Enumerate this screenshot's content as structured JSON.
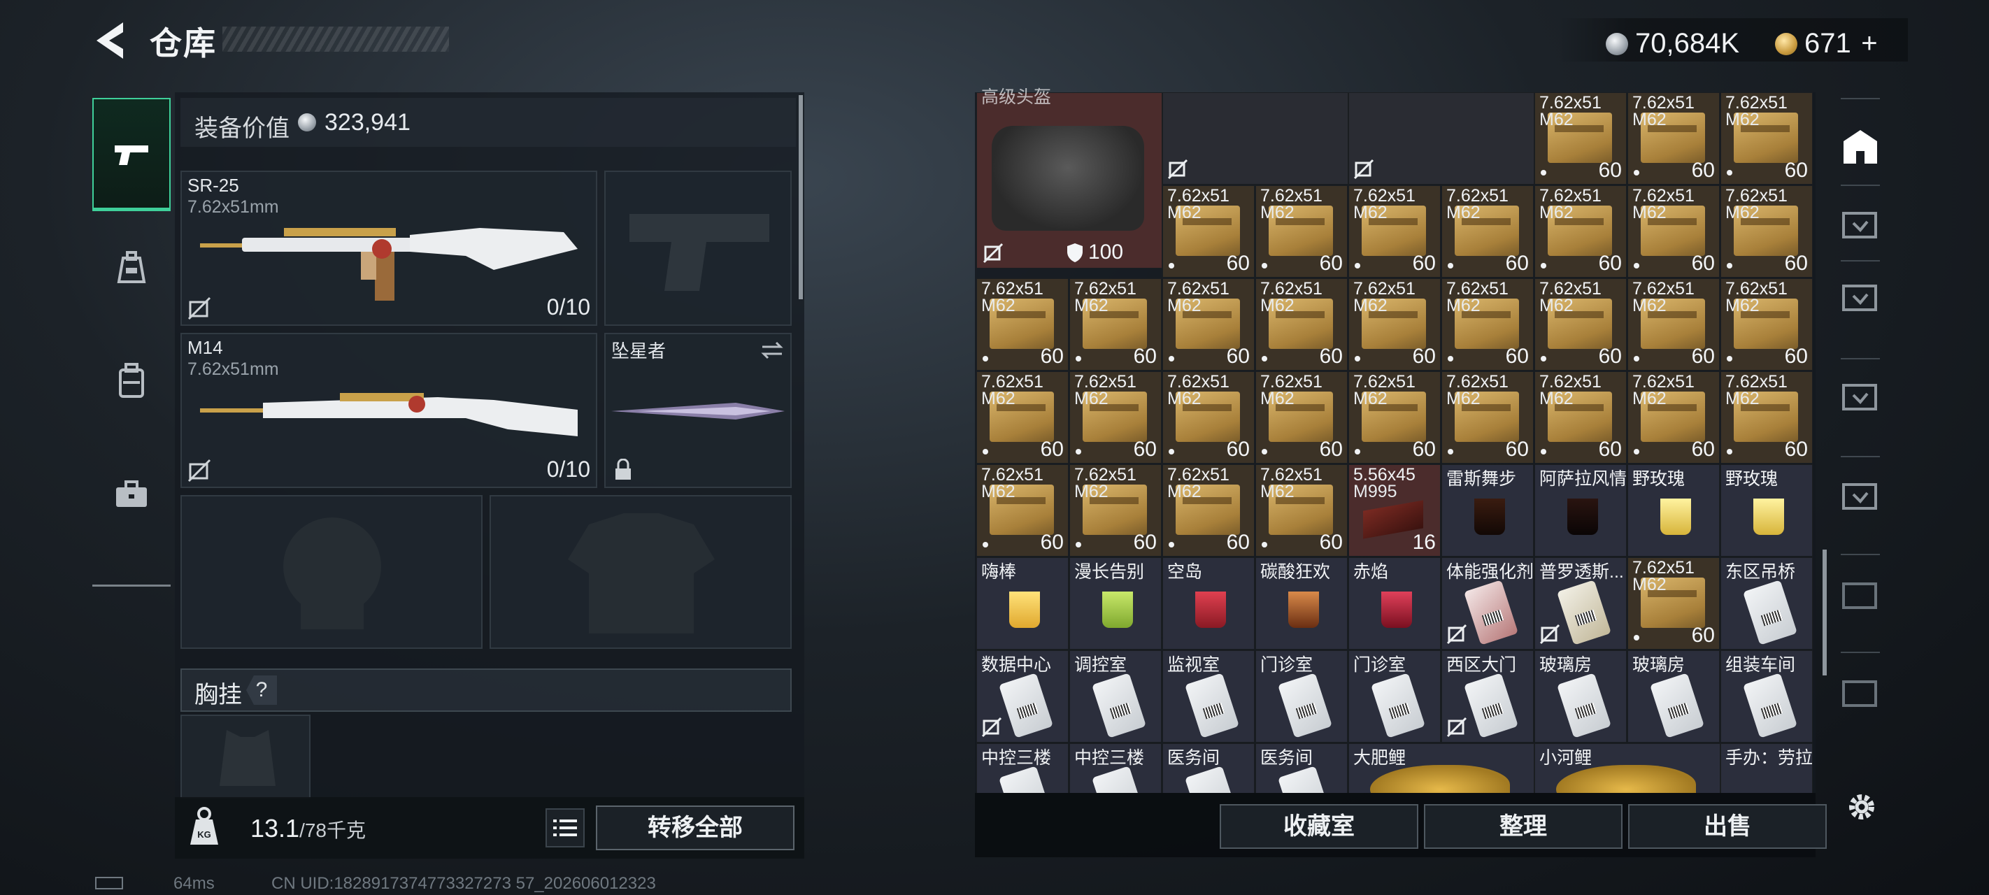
{
  "header": {
    "title": "仓库",
    "currency_silver": "70,684K",
    "currency_gold": "671",
    "add_symbol": "+"
  },
  "equipment": {
    "value_label": "装备价值",
    "value": "323,941",
    "slots": [
      {
        "name": "SR-25",
        "ammo": "7.62x51mm",
        "count": "0/10"
      },
      {
        "name": "M14",
        "ammo": "7.62x51mm",
        "count": "0/10"
      },
      {
        "name": "坠星者"
      }
    ],
    "chest_label": "胸挂",
    "chest_help": "?",
    "weight": "13.1",
    "weight_capacity": "/78千克",
    "transfer_all": "转移全部"
  },
  "status": {
    "ping": "64ms",
    "uid": "CN UID:1828917374773327273 57_202606012323"
  },
  "storage": {
    "top_label": "高级头盔",
    "bag_durability": "100",
    "ammo_line1": "7.62x51",
    "ammo_line2": "M62",
    "ammo_count": "60",
    "ammo556_line1": "5.56x45",
    "ammo556_line2": "M995",
    "ammo556_count": "16",
    "items": [
      "雷斯舞步",
      "阿萨拉风情",
      "野玫瑰",
      "野玫瑰",
      "嗨棒",
      "漫长告别",
      "空岛",
      "碳酸狂欢",
      "赤焰",
      "体能强化剂",
      "普罗透斯...",
      "东区吊桥",
      "数据中心",
      "调控室",
      "监视室",
      "门诊室",
      "门诊室",
      "西区大门",
      "玻璃房",
      "玻璃房",
      "组装车间",
      "中控三楼",
      "中控三楼",
      "医务间",
      "医务间",
      "大肥鲤",
      "小河鲤",
      "手办：劳拉"
    ],
    "buttons": {
      "collection": "收藏室",
      "organize": "整理",
      "sell": "出售"
    }
  },
  "colors": {
    "accent_green": "#3fd09a",
    "ammo_cell_bg": "#3b3226",
    "red_cell_bg": "#4b2c2c",
    "blue_cell_bg": "#2b2e3c"
  }
}
